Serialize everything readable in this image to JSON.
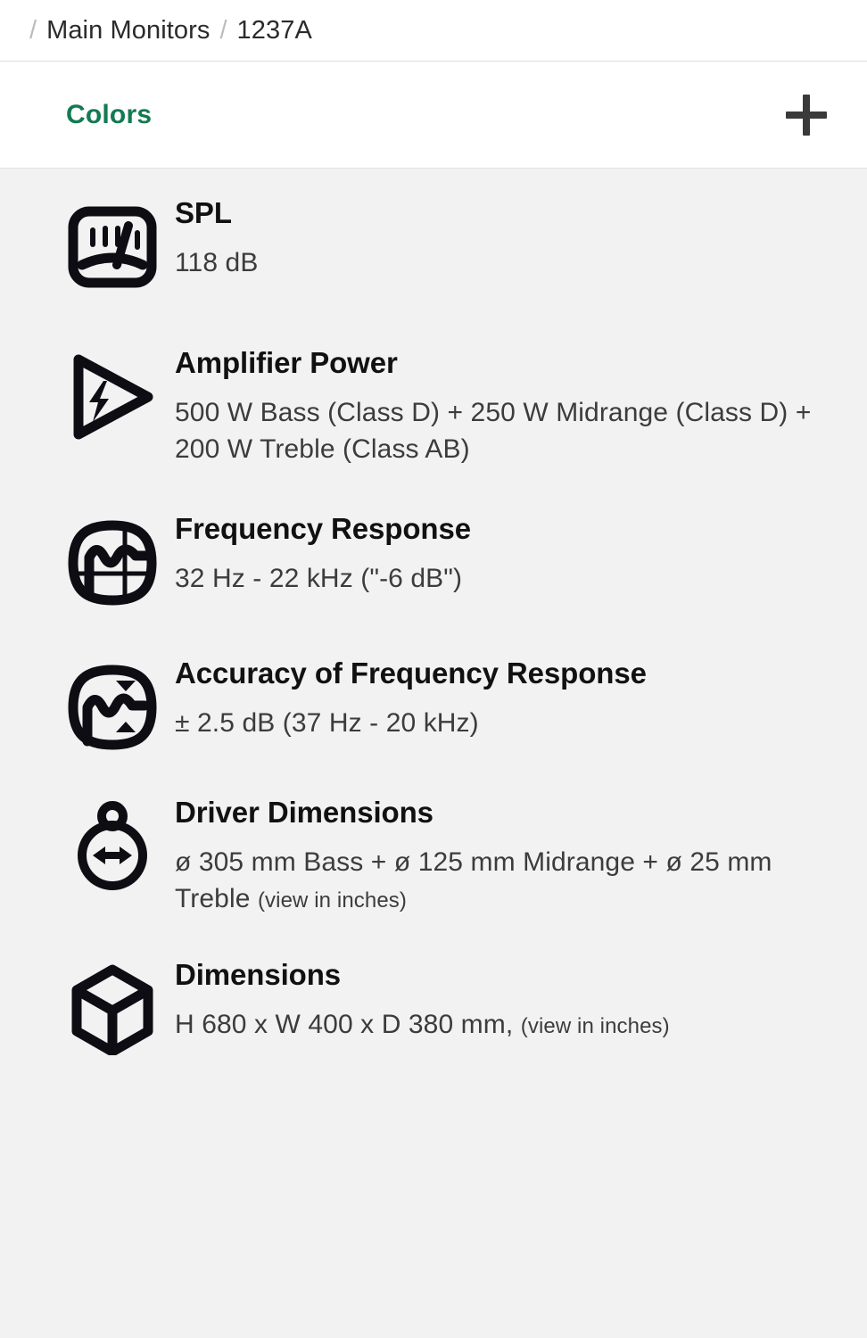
{
  "breadcrumb": {
    "separator": "/",
    "items": [
      {
        "label": "Main Monitors"
      },
      {
        "label": "1237A"
      }
    ]
  },
  "accordion": {
    "title": "Colors",
    "expand_icon": "plus-icon",
    "accent_color": "#137a52"
  },
  "specs": [
    {
      "icon": "vu-meter-icon",
      "title": "SPL",
      "value": "118 dB",
      "note": ""
    },
    {
      "icon": "amplifier-power-icon",
      "title": "Amplifier Power",
      "value": "500 W Bass (Class D) + 250 W Midrange (Class D) + 200 W Treble (Class AB)",
      "note": ""
    },
    {
      "icon": "frequency-response-icon",
      "title": "Frequency Response",
      "value": "32 Hz - 22 kHz (\"-6 dB\")",
      "note": ""
    },
    {
      "icon": "accuracy-frequency-response-icon",
      "title": "Accuracy of Frequency Response",
      "value": "± 2.5 dB (37 Hz - 20 kHz)",
      "note": ""
    },
    {
      "icon": "driver-dimensions-icon",
      "title": "Driver Dimensions",
      "value": "ø 305 mm Bass + ø 125 mm Midrange + ø 25 mm Treble ",
      "note": "(view in inches)"
    },
    {
      "icon": "cube-icon",
      "title": "Dimensions",
      "value": "H 680 x W 400 x D 380 mm, ",
      "note": "(view in inches)"
    }
  ],
  "colors": {
    "page_background": "#f2f2f2",
    "card_background": "#ffffff",
    "title_text": "#111111",
    "value_text": "#3c3c3c",
    "breadcrumb_separator": "#bcbcbc"
  }
}
